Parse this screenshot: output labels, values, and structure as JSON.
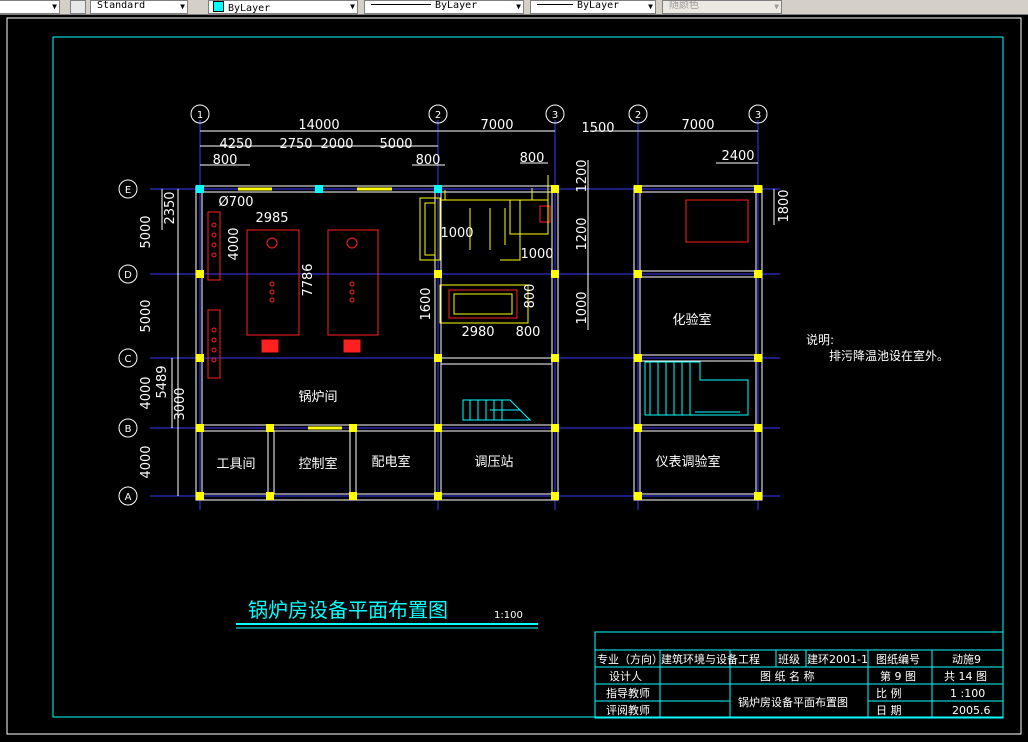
{
  "toolbar": {
    "textstyle": "Standard",
    "color": "ByLayer",
    "linetype": "ByLayer",
    "lineweight": "ByLayer",
    "plotstyle": "随颜色"
  },
  "colors": {
    "cyan": "#00ffff",
    "yellow": "#ffff00",
    "red": "#ff2020",
    "white": "#ffffff",
    "blue": "#3030ff"
  },
  "drawing": {
    "axes_top": [
      "1",
      "2",
      "3",
      "2",
      "3"
    ],
    "axes_left": [
      "E",
      "D",
      "C",
      "B",
      "A"
    ],
    "dims_top": [
      "14000",
      "7000",
      "7000",
      "4250",
      "2750",
      "2000",
      "5000",
      "800",
      "800",
      "800",
      "1500",
      "2400"
    ],
    "dims_left": [
      "2350",
      "5000",
      "5000",
      "5489",
      "4000",
      "3000",
      "4000"
    ],
    "dims_right": [
      "1200",
      "1200",
      "1000",
      "1800"
    ],
    "dims_inner": [
      "Ø700",
      "2985",
      "4000",
      "7786",
      "1000",
      "1000",
      "1600",
      "800",
      "2980",
      "800"
    ],
    "rooms": [
      "锅炉间",
      "工具间",
      "控制室",
      "配电室",
      "调压站",
      "化验室",
      "仪表调验室"
    ],
    "note_title": "说明:",
    "note_text": "排污降温池设在室外。",
    "main_title": "锅炉房设备平面布置图",
    "scale": "1:100"
  },
  "title_block": {
    "major_label": "专业（方向）",
    "major": "建筑环境与设备工程",
    "class_label": "班级",
    "class": "建环2001-1",
    "drawing_no_label": "图纸编号",
    "drawing_no": "动施9",
    "designer_label": "设计人",
    "drawing_name_label": "图 纸 名 称",
    "sheet": "第 9 图",
    "total": "共 14 图",
    "advisor_label": "指导教师",
    "drawing_name": "锅炉房设备平面布置图",
    "scale_label": "比  例",
    "scale": "1 :100",
    "reviewer_label": "评阅教师",
    "date_label": "日  期",
    "date": "2005.6"
  }
}
